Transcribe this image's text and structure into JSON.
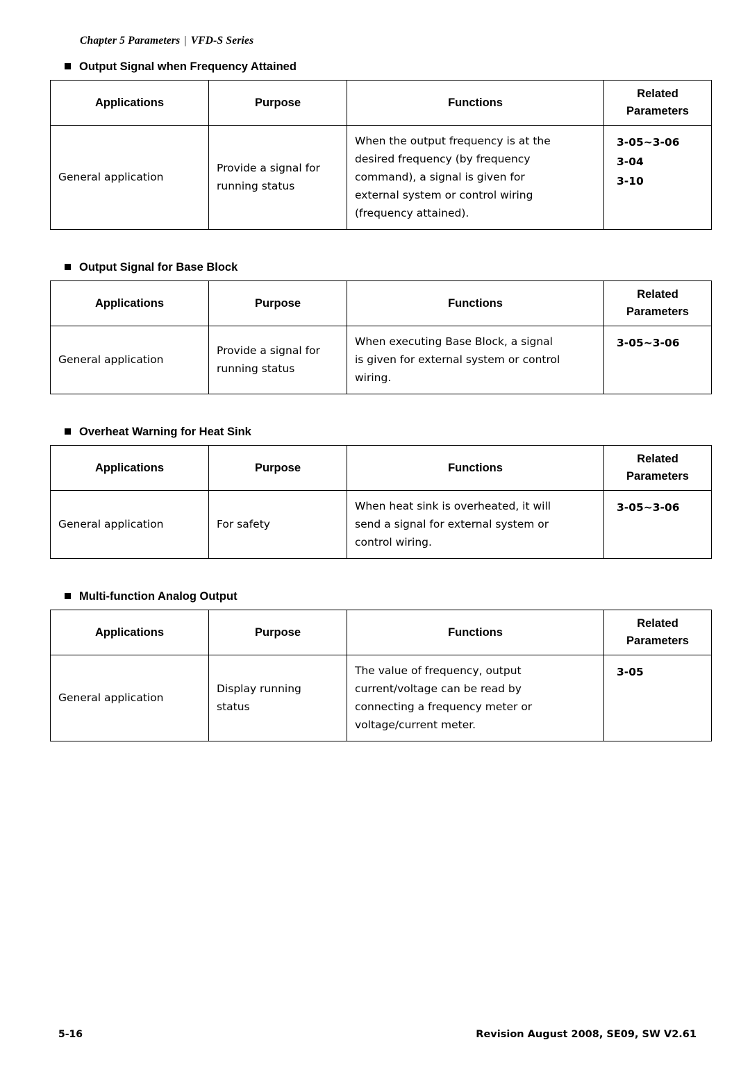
{
  "header": {
    "chapter": "Chapter 5 Parameters",
    "separator": "|",
    "series": "VFD-S Series"
  },
  "columns": {
    "applications": "Applications",
    "purpose": "Purpose",
    "functions": "Functions",
    "related_line1": "Related",
    "related_line2": "Parameters"
  },
  "sections": [
    {
      "title": "Output Signal when Frequency Attained",
      "row": {
        "applications": "General application",
        "purpose_lines": [
          "Provide a signal for",
          "running status"
        ],
        "functions_lines": [
          "When the output frequency is at the",
          "desired frequency (by frequency",
          "command), a signal is given for",
          "external system or control wiring",
          "(frequency attained)."
        ],
        "related_lines": [
          "3-05~3-06",
          "3-04",
          "3-10"
        ]
      }
    },
    {
      "title": "Output Signal for Base Block",
      "row": {
        "applications": "General application",
        "purpose_lines": [
          "Provide a signal for",
          "running status"
        ],
        "functions_lines": [
          "When executing Base Block, a signal",
          "is given for external system or control",
          "wiring."
        ],
        "related_lines": [
          "3-05~3-06"
        ]
      }
    },
    {
      "title": "Overheat Warning for Heat Sink",
      "row": {
        "applications": "General application",
        "purpose_lines": [
          "For safety"
        ],
        "functions_lines": [
          "When heat sink is overheated, it will",
          "send a signal for external system or",
          "control wiring."
        ],
        "related_lines": [
          "3-05~3-06"
        ]
      }
    },
    {
      "title": "Multi-function Analog Output",
      "row": {
        "applications": "General application",
        "purpose_lines": [
          "Display running",
          "status"
        ],
        "functions_lines": [
          "The value of frequency, output",
          "current/voltage can be read by",
          "connecting a frequency meter or",
          "voltage/current meter."
        ],
        "related_lines": [
          "3-05"
        ]
      }
    }
  ],
  "footer": {
    "page_number": "5-16",
    "revision": "Revision August 2008, SE09, SW V2.61"
  }
}
